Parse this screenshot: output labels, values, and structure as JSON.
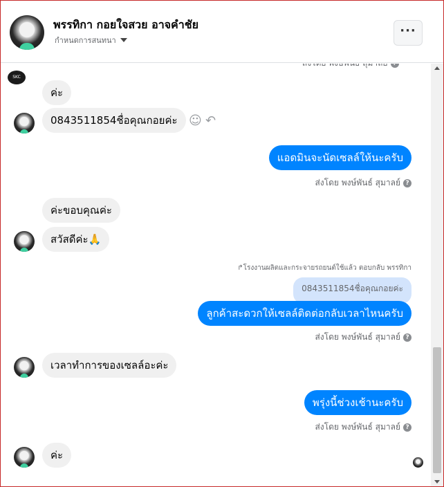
{
  "header": {
    "title": "พรรทิกา กอยใจสวย อาจคำชัย",
    "subtitle": "กำหนดการสนทนา",
    "more_label": "···"
  },
  "messages": {
    "m0_sent_by": "ส่งโดย พงษ์พันธ์ สุมาลย์",
    "m1": "ค่ะ",
    "m2": "0843511854ชื่อคุณกอยค่ะ",
    "m3": "แอดมินจะนัดเซลล์ให้นะครับ",
    "m3_sent_by": "ส่งโดย พงษ์พันธ์ สุมาลย์",
    "m4": "ค่ะขอบคุณค่ะ",
    "m5": "สวัสดีค่ะ🙏",
    "reply_note": "↱โรงงานผลิตและกระจายรถยนต์ใช้แล้ว ตอบกลับ พรรทิกา",
    "quoted": "0843511854ชื่อคุณกอยค่ะ",
    "m6": "ลูกค้าสะดวกให้เซลล์ติดต่อกลับเวลาไหนครับ",
    "m6_sent_by": "ส่งโดย พงษ์พันธ์ สุมาลย์",
    "m7": "เวลาทำการของเซลล์อะค่ะ",
    "m8": "พรุ่งนี้ช่วงเช้านะครับ",
    "m8_sent_by": "ส่งโดย พงษ์พันธ์ สุมาลย์",
    "m9": "ค่ะ"
  },
  "icons": {
    "help": "?",
    "emoji": "☺",
    "reply": "↶",
    "page_logo": "SKC"
  },
  "colors": {
    "outgoing": "#0084ff",
    "incoming": "#f0f0f0",
    "quoted": "#d3e4fc"
  }
}
